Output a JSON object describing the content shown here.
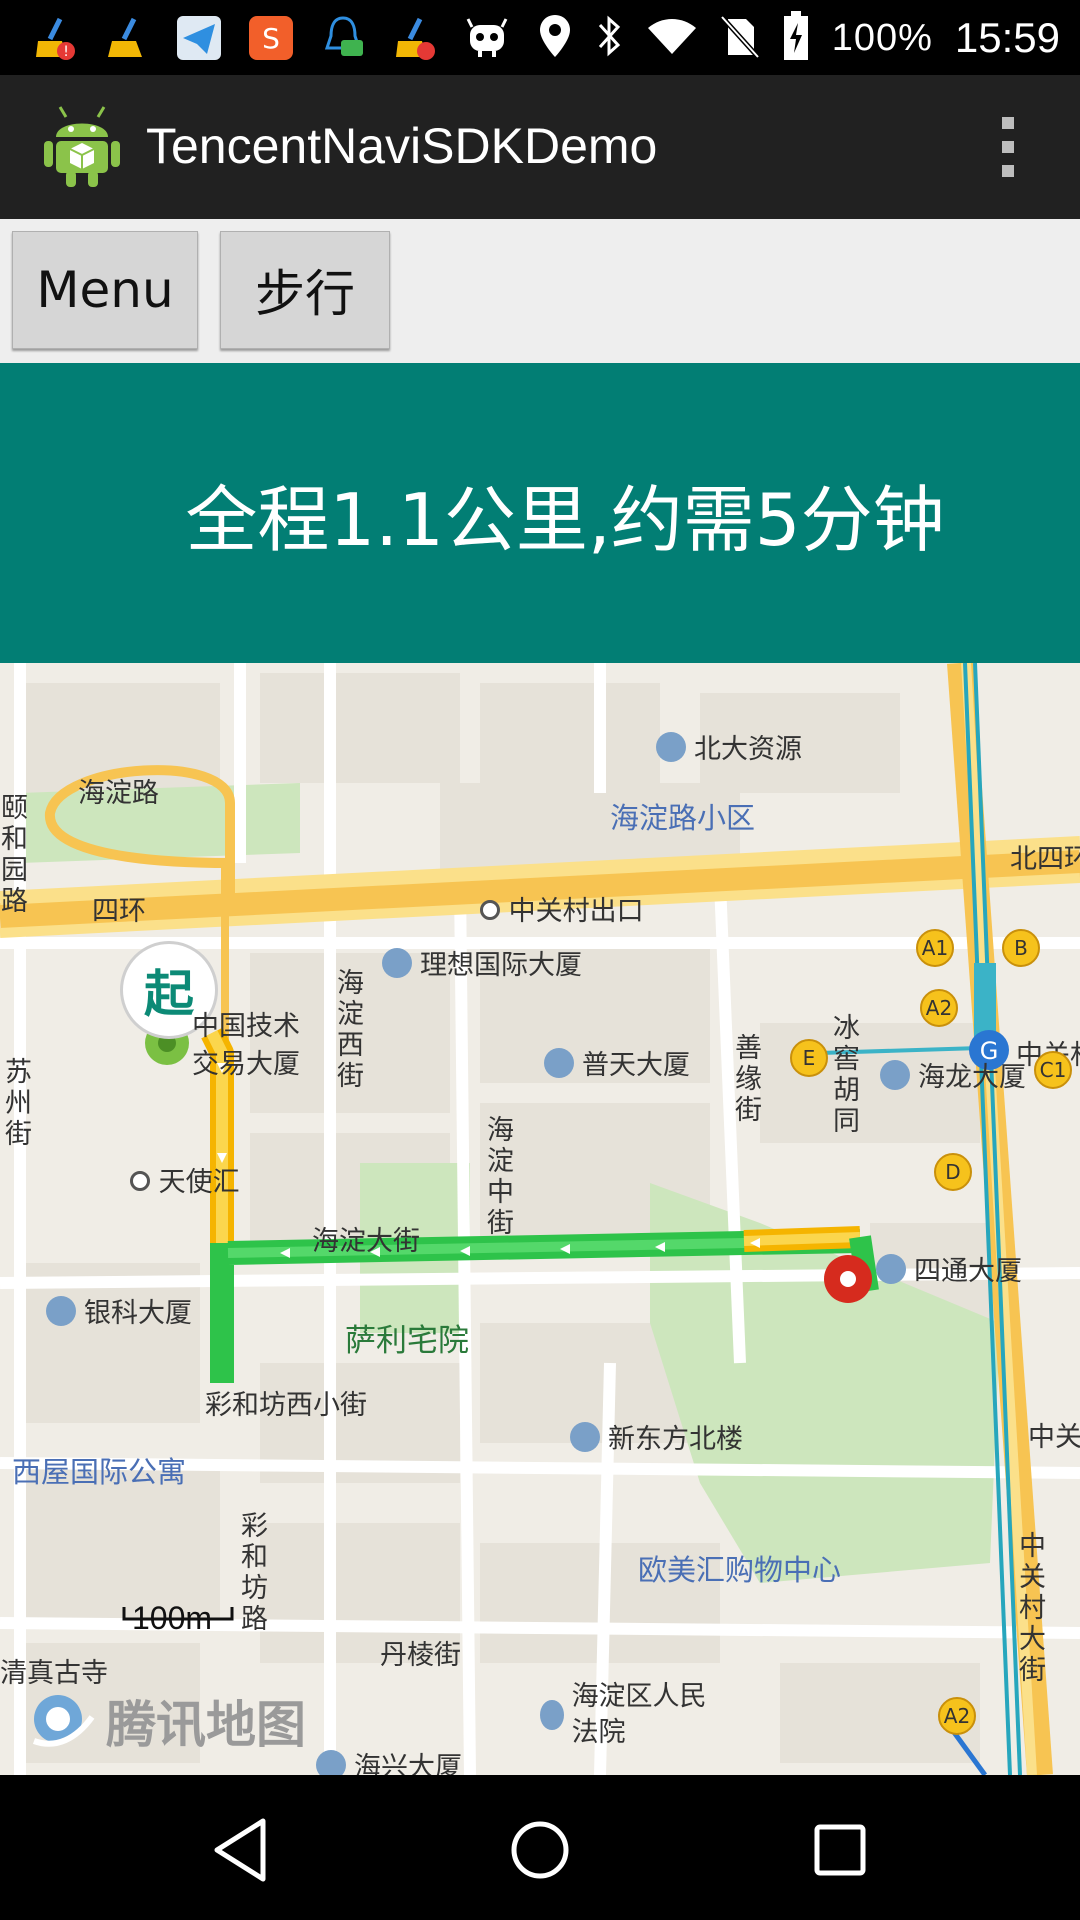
{
  "status_bar": {
    "battery": "100%",
    "time": "15:59",
    "icons": [
      "cleaner-alert-icon",
      "broom-icon",
      "telegram-icon",
      "sogou-input-icon",
      "qq-notification-icon",
      "cleaner-alert-icon",
      "robot-icon",
      "location-icon",
      "bluetooth-icon",
      "wifi-icon",
      "no-sim-icon",
      "battery-charging-icon"
    ]
  },
  "action_bar": {
    "title": "TencentNaviSDKDemo"
  },
  "toolbar": {
    "menu_label": "Menu",
    "walk_label": "步行"
  },
  "banner": {
    "summary": "全程1.1公里,约需5分钟"
  },
  "map": {
    "start_marker": "起",
    "scale_label": "100m",
    "logo_text": "腾讯地图",
    "labels": {
      "haidian_road": "海淀路",
      "fourth_ring": "四环",
      "north_fourth_ring": "北四环",
      "zgc_exit": "中关村出口",
      "haidian_west_st": "海淀西街",
      "haidian_middle_st": "海淀中街",
      "haidian_st": "海淀大街",
      "shanyuan_st": "善缘街",
      "binghu_hutong": "冰窖胡同",
      "tianhui": "天使汇",
      "sali_park": "萨利宅院",
      "caihefang_west_lane": "彩和坊西小街",
      "caihefang_road": "彩和坊路",
      "danleng_st": "丹棱街",
      "qingzhen": "清真古寺",
      "suzhou_st": "苏州街",
      "zgc_st": "中关村大街",
      "zgc_east": "中关",
      "zgc_station": "中关村",
      "haidian_road_area": "海淀路小区",
      "ouhui_mall": "欧美汇购物中心",
      "xiwu_apartment": "西屋国际公寓",
      "left_edge_road": "颐和园路"
    },
    "pois": {
      "pku_resource": "北大资源",
      "lixiang_tower": "理想国际大厦",
      "zgjs_tower": "中国技术交易大厦",
      "putian_tower": "普天大厦",
      "hailong_tower": "海龙大厦",
      "sitong_tower": "四通大厦",
      "yinke_tower": "银科大厦",
      "xdf_tower": "新东方北楼",
      "court": "海淀区人民法院",
      "haixing_tower": "海兴大厦"
    },
    "exits": [
      "A1",
      "B",
      "A2",
      "E",
      "C1",
      "D",
      "A2"
    ]
  }
}
